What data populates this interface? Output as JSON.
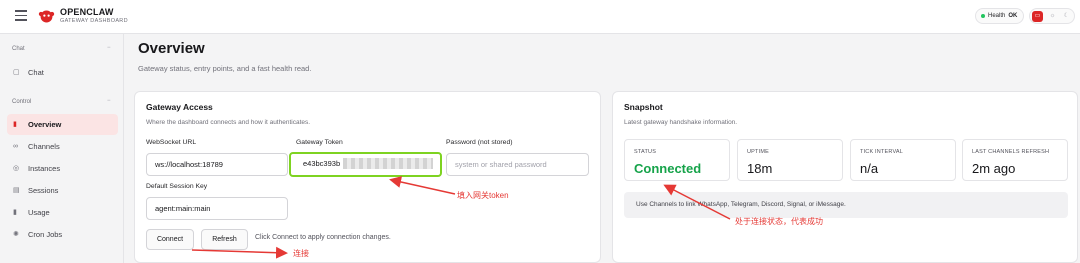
{
  "brand": {
    "name": "OPENCLAW",
    "subtitle": "GATEWAY DASHBOARD"
  },
  "health": {
    "label": "Health",
    "status": "OK",
    "color": "#22c55e"
  },
  "sidebar": {
    "groups": [
      {
        "label": "Chat",
        "items": [
          {
            "label": "Chat",
            "icon": "chat-bubble-icon"
          }
        ]
      },
      {
        "label": "Control",
        "items": [
          {
            "label": "Overview",
            "icon": "bar-chart-icon",
            "active": true
          },
          {
            "label": "Channels",
            "icon": "link-icon"
          },
          {
            "label": "Instances",
            "icon": "radio-icon"
          },
          {
            "label": "Sessions",
            "icon": "document-icon"
          },
          {
            "label": "Usage",
            "icon": "bar-chart-icon"
          },
          {
            "label": "Cron Jobs",
            "icon": "loader-icon"
          }
        ]
      }
    ]
  },
  "page": {
    "title": "Overview",
    "subtitle": "Gateway status, entry points, and a fast health read."
  },
  "access": {
    "title": "Gateway Access",
    "subtitle": "Where the dashboard connects and how it authenticates.",
    "websocket_label": "WebSocket URL",
    "websocket_value": "ws://localhost:18789",
    "token_label": "Gateway Token",
    "token_value": "e43bc393b",
    "password_label": "Password (not stored)",
    "password_placeholder": "system or shared password",
    "session_label": "Default Session Key",
    "session_value": "agent:main:main",
    "connect_label": "Connect",
    "refresh_label": "Refresh",
    "hint": "Click Connect to apply connection changes."
  },
  "snapshot": {
    "title": "Snapshot",
    "subtitle": "Latest gateway handshake information.",
    "stats": [
      {
        "label": "STATUS",
        "value": "Connected",
        "good": true
      },
      {
        "label": "UPTIME",
        "value": "18m"
      },
      {
        "label": "TICK INTERVAL",
        "value": "n/a"
      },
      {
        "label": "LAST CHANNELS REFRESH",
        "value": "2m ago"
      }
    ],
    "notice": "Use Channels to link WhatsApp, Telegram, Discord, Signal, or iMessage."
  },
  "annotations": {
    "token": "填入网关token",
    "connect": "连接",
    "status": "处于连接状态，代表成功",
    "color": "#e53935"
  },
  "colors": {
    "accent": "#dc2626",
    "highlight": "#7ed321",
    "success": "#16a34a"
  }
}
